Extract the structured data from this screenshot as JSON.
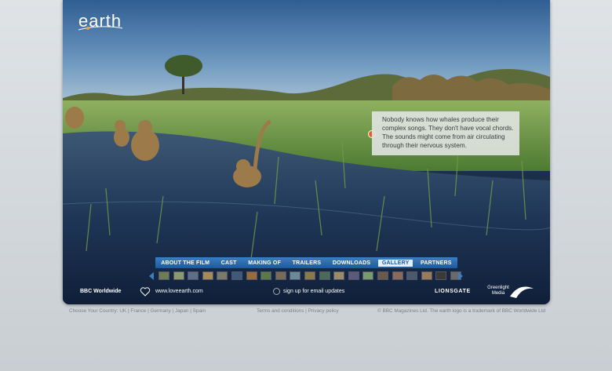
{
  "brand": {
    "logo_text": "earth"
  },
  "fact_box": {
    "text": "Nobody knows how whales produce their complex songs. They don't have vocal chords. The sounds might come from air circulating through their nervous system."
  },
  "nav": {
    "items": [
      "ABOUT THE FILM",
      "CAST",
      "MAKING OF",
      "TRAILERS",
      "DOWNLOADS",
      "GALLERY",
      "PARTNERS"
    ],
    "active": "GALLERY"
  },
  "thumbnails": {
    "count": 21
  },
  "footer": {
    "bbc": "BBC Worldwide",
    "site": "www.loveearth.com",
    "signup": "sign up for email updates",
    "lionsgate": "LIONSGATE",
    "greenlight": "Greenlight Media"
  },
  "bottom": {
    "country_label": "Choose Your Country:",
    "countries": [
      "UK",
      "France",
      "Germany",
      "Japan",
      "Spain"
    ],
    "terms": "Terms and conditions",
    "privacy": "Privacy policy",
    "copyright": "© BBC Magazines Ltd. The earth logo is a trademark of BBC Worldwide Ltd"
  },
  "colors": {
    "nav": "#2a6bb0",
    "fact_dot": "#e0642a"
  }
}
